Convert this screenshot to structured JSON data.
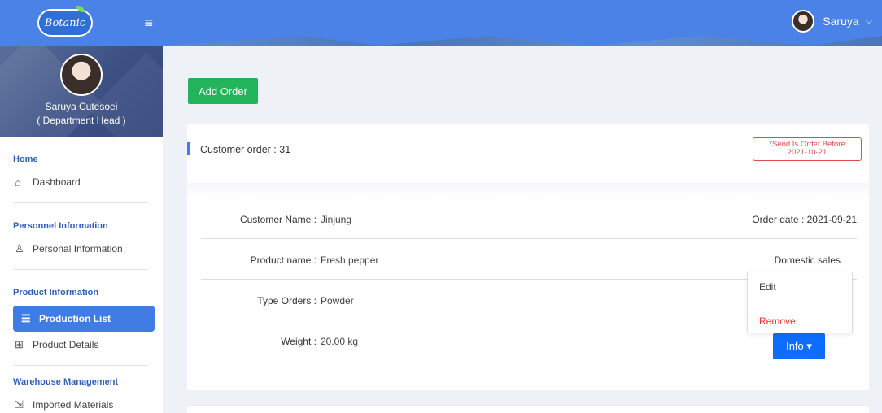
{
  "brand": {
    "logo_text": "Botanic"
  },
  "topbar": {
    "user_name": "Saruya",
    "chevron": "⌵"
  },
  "profile": {
    "name": "Saruya Cutesoei",
    "role": "( Department Head )"
  },
  "sidebar": {
    "sections": [
      {
        "title": "Home",
        "items": [
          {
            "icon": "home-icon",
            "label": "Dashboard"
          }
        ]
      },
      {
        "title": "Personnel Information",
        "items": [
          {
            "icon": "person-icon",
            "label": "Personal Information"
          }
        ]
      },
      {
        "title": "Product Information",
        "items": [
          {
            "icon": "list-icon",
            "label": "Production List",
            "active": true
          },
          {
            "icon": "grid-icon",
            "label": "Product Details"
          }
        ]
      },
      {
        "title": "Warehouse Management",
        "items": [
          {
            "icon": "import-icon",
            "label": "Imported Materials"
          }
        ]
      }
    ]
  },
  "main": {
    "add_order_label": "Add Order",
    "order": {
      "title": "Customer order : 31",
      "send_badge_line1": "*Send Is Order Before",
      "send_badge_line2": "2021-10-21",
      "customer_label": "Customer Name :",
      "customer_value": "Jinjung",
      "order_date": "Order date : 2021-09-21",
      "product_label": "Product name :",
      "product_value": "Fresh pepper",
      "sales_type": "Domestic sales",
      "type_label": "Type Orders :",
      "type_value": "Powder",
      "weight_label": "Weight :",
      "weight_value": "20.00 kg"
    },
    "dropdown": {
      "edit_label": "Edit",
      "remove_label": "Remove"
    },
    "info_label": "Info ▾"
  },
  "colors": {
    "primary": "#4b82e8",
    "success": "#23b35a",
    "danger": "#e24b4b",
    "info_button": "#0d6efd"
  }
}
